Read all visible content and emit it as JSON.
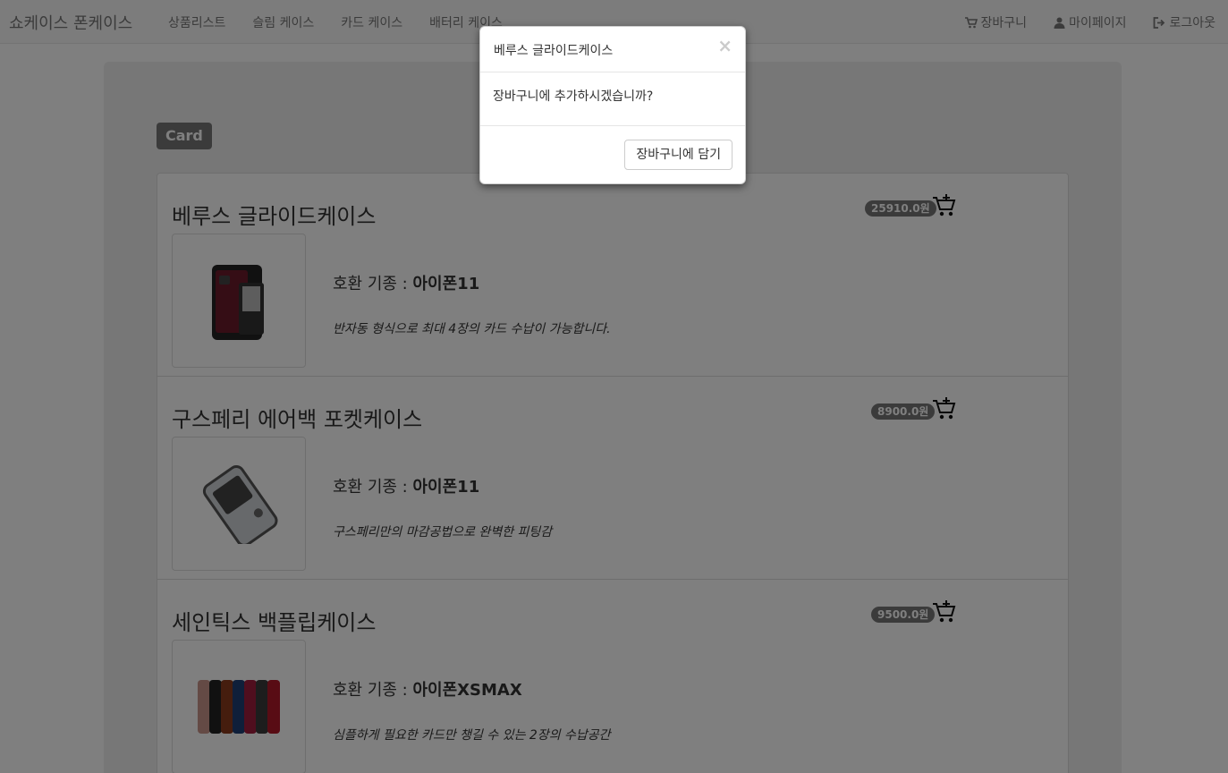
{
  "navbar": {
    "brand": "쇼케이스 폰케이스",
    "links": [
      "상품리스트",
      "슬림 케이스",
      "카드 케이스",
      "배터리 케이스"
    ],
    "right": [
      {
        "label": "장바구니",
        "icon": "cart-icon"
      },
      {
        "label": "마이페이지",
        "icon": "user-icon"
      },
      {
        "label": "로그아웃",
        "icon": "logout-icon"
      }
    ]
  },
  "category_badge": "Card",
  "compat_prefix": "호환 기종 : ",
  "products": [
    {
      "name": "베루스 글라이드케이스",
      "model": "아이폰11",
      "description": "반자동 형식으로 최대 4장의 카드 수납이 가능합니다.",
      "price": "25910.0원"
    },
    {
      "name": "구스페리 에어백 포켓케이스",
      "model": "아이폰11",
      "description": "구스페리만의 마감공법으로 완벽한 피팅감",
      "price": "8900.0원"
    },
    {
      "name": "세인틱스 백플립케이스",
      "model": "아이폰XSMAX",
      "description": "심플하게 필요한 카드만 챙길 수 있는 2장의 수납공간",
      "price": "9500.0원"
    }
  ],
  "modal": {
    "title": "베루스 글라이드케이스",
    "close": "×",
    "body": "장바구니에 추가하시겠습니까?",
    "confirm_label": "장바구니에 담기"
  },
  "colors": {
    "badge_bg": "#777777",
    "jumbotron_bg": "#eeeeee",
    "backdrop": "rgba(0,0,0,0.5)"
  }
}
